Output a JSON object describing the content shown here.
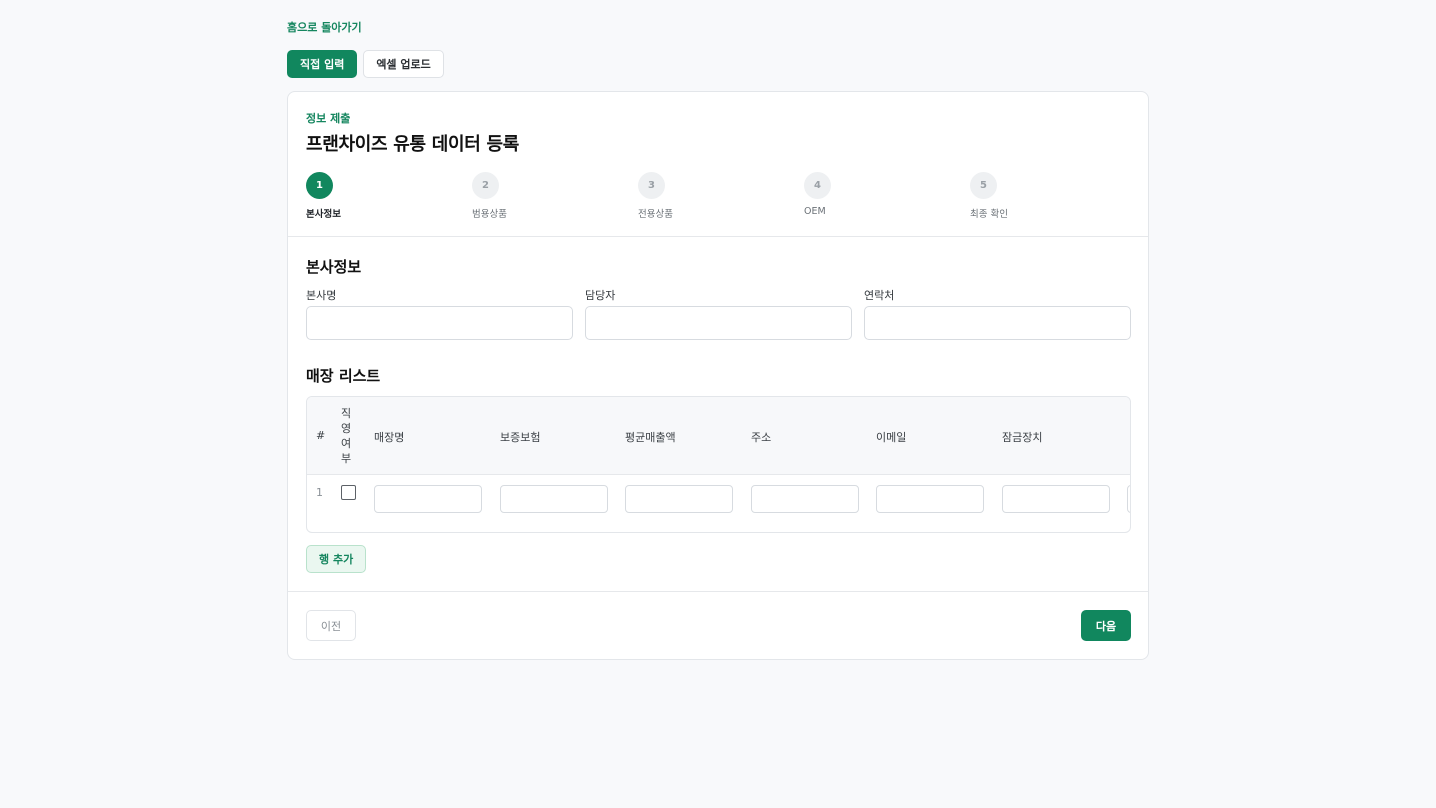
{
  "nav": {
    "back_label": "홈으로 돌아가기"
  },
  "mode_tabs": [
    {
      "label": "직접 입력",
      "active": true
    },
    {
      "label": "엑셀 업로드",
      "active": false
    }
  ],
  "header": {
    "eyebrow": "정보 제출",
    "title": "프랜차이즈 유통 데이터 등록"
  },
  "steps": [
    {
      "number": "1",
      "label": "본사정보",
      "current": true
    },
    {
      "number": "2",
      "label": "범용상품",
      "current": false
    },
    {
      "number": "3",
      "label": "전용상품",
      "current": false
    },
    {
      "number": "4",
      "label": "OEM",
      "current": false
    },
    {
      "number": "5",
      "label": "최종 확인",
      "current": false
    }
  ],
  "hq_section": {
    "title": "본사정보",
    "fields": [
      {
        "label": "본사명",
        "value": ""
      },
      {
        "label": "담당자",
        "value": ""
      },
      {
        "label": "연락처",
        "value": ""
      }
    ]
  },
  "store_section": {
    "title": "매장 리스트",
    "columns": {
      "index": "#",
      "direct": "직영여부",
      "store_name": "매장명",
      "insurance": "보증보험",
      "avg_sales": "평균매출액",
      "address": "주소",
      "email": "이메일",
      "lock": "잠금장치"
    },
    "rows": [
      {
        "index": "1",
        "direct": false,
        "store_name": "",
        "insurance": "",
        "avg_sales": "",
        "address": "",
        "email": "",
        "lock": ""
      }
    ],
    "add_row_label": "행 추가"
  },
  "footer": {
    "prev_label": "이전",
    "next_label": "다음"
  },
  "colors": {
    "accent": "#11875e",
    "accent_text": "#15865f",
    "background": "#f8f9fb"
  }
}
